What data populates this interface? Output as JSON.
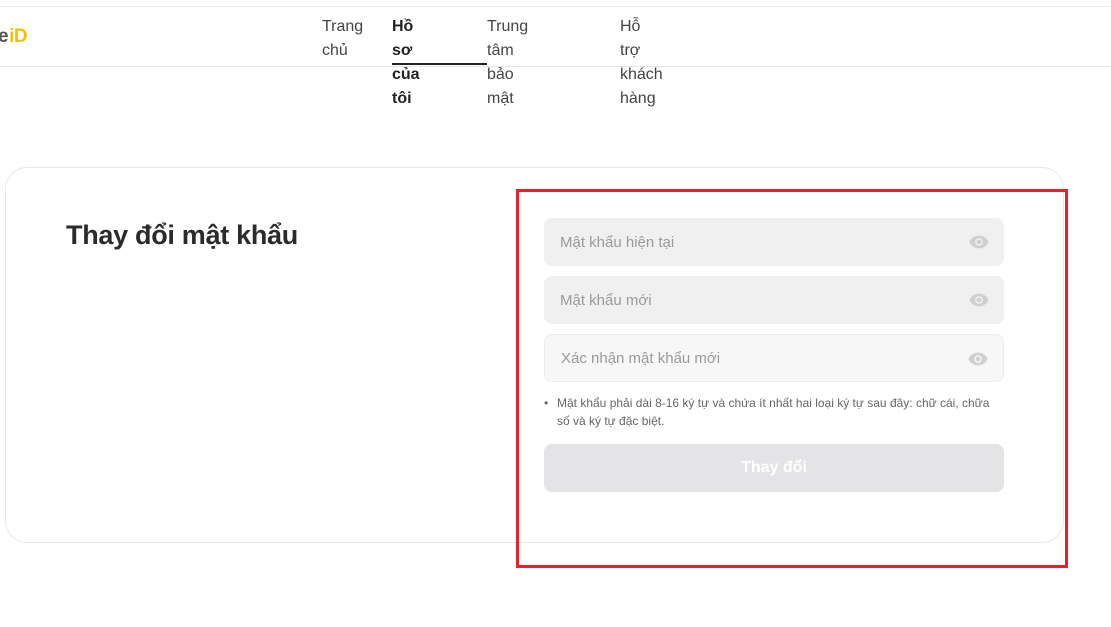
{
  "logo": {
    "left_text": "e",
    "brand_text": "iD"
  },
  "nav": {
    "items": [
      {
        "line1": "Trang",
        "line2": "chủ"
      },
      {
        "line1": "Hồ sơ của",
        "line2": "tôi",
        "active": true
      },
      {
        "line1": "Trung tâm bảo",
        "line2": "mật"
      },
      {
        "line1": "Hỗ trợ khách",
        "line2": "hàng"
      }
    ]
  },
  "page": {
    "title": "Thay đổi mật khẩu"
  },
  "form": {
    "current_password": {
      "placeholder": "Mật khẩu hiện tại",
      "value": ""
    },
    "new_password": {
      "placeholder": "Mật khẩu mới",
      "value": ""
    },
    "confirm_password": {
      "placeholder": "Xác nhận mật khẩu mới",
      "value": ""
    },
    "hint_bullet": "•",
    "hint": "Mật khẩu phải dài 8-16 ký tự và chứa ít nhất hai loại ký tự sau đây: chữ cái, chữa số và ký tự đặc biệt.",
    "submit_label": "Thay đổi"
  },
  "icons": {
    "visibility": "eye-icon"
  },
  "colors": {
    "accent_yellow": "#f2c200",
    "highlight_red": "#e8212a",
    "field_bg": "#f0f0f1",
    "button_disabled_bg": "#e4e4e6"
  }
}
